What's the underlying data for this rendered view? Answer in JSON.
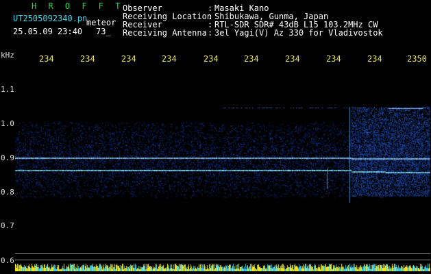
{
  "header": {
    "logo": "H R O F F T",
    "filename": "UT2505092340.pn",
    "meteor_label": "meteor",
    "date_time": "25.05.09 23:40",
    "count": "73_"
  },
  "info": {
    "rows": [
      {
        "label": "Observer",
        "value": "Masaki Kano"
      },
      {
        "label": "Receiving Location",
        "value": "Shibukawa, Gunma, Japan"
      },
      {
        "label": "Receiver",
        "value": "RTL-SDR SDR# 43dB L15 103.2MHz CW"
      },
      {
        "label": "Receiving Antenna",
        "value": "3el Yagi(V) Az 330 for Vladivostok"
      }
    ],
    "separator": ":"
  },
  "y_axis": {
    "unit": "kHz",
    "ticks": [
      "1.1",
      "1.0",
      "0.9",
      "0.8",
      "0.7",
      "0.6"
    ]
  },
  "x_axis": {
    "ticks": [
      "234",
      "234",
      "234",
      "234",
      "234",
      "234",
      "234",
      "234",
      "234",
      "2350"
    ]
  },
  "colors": {
    "background": "#000000",
    "noise": "#1a3cff",
    "line": "#7fd6ff",
    "bottom_strip": "#f2e320",
    "grid": "#8a8a8a"
  }
}
